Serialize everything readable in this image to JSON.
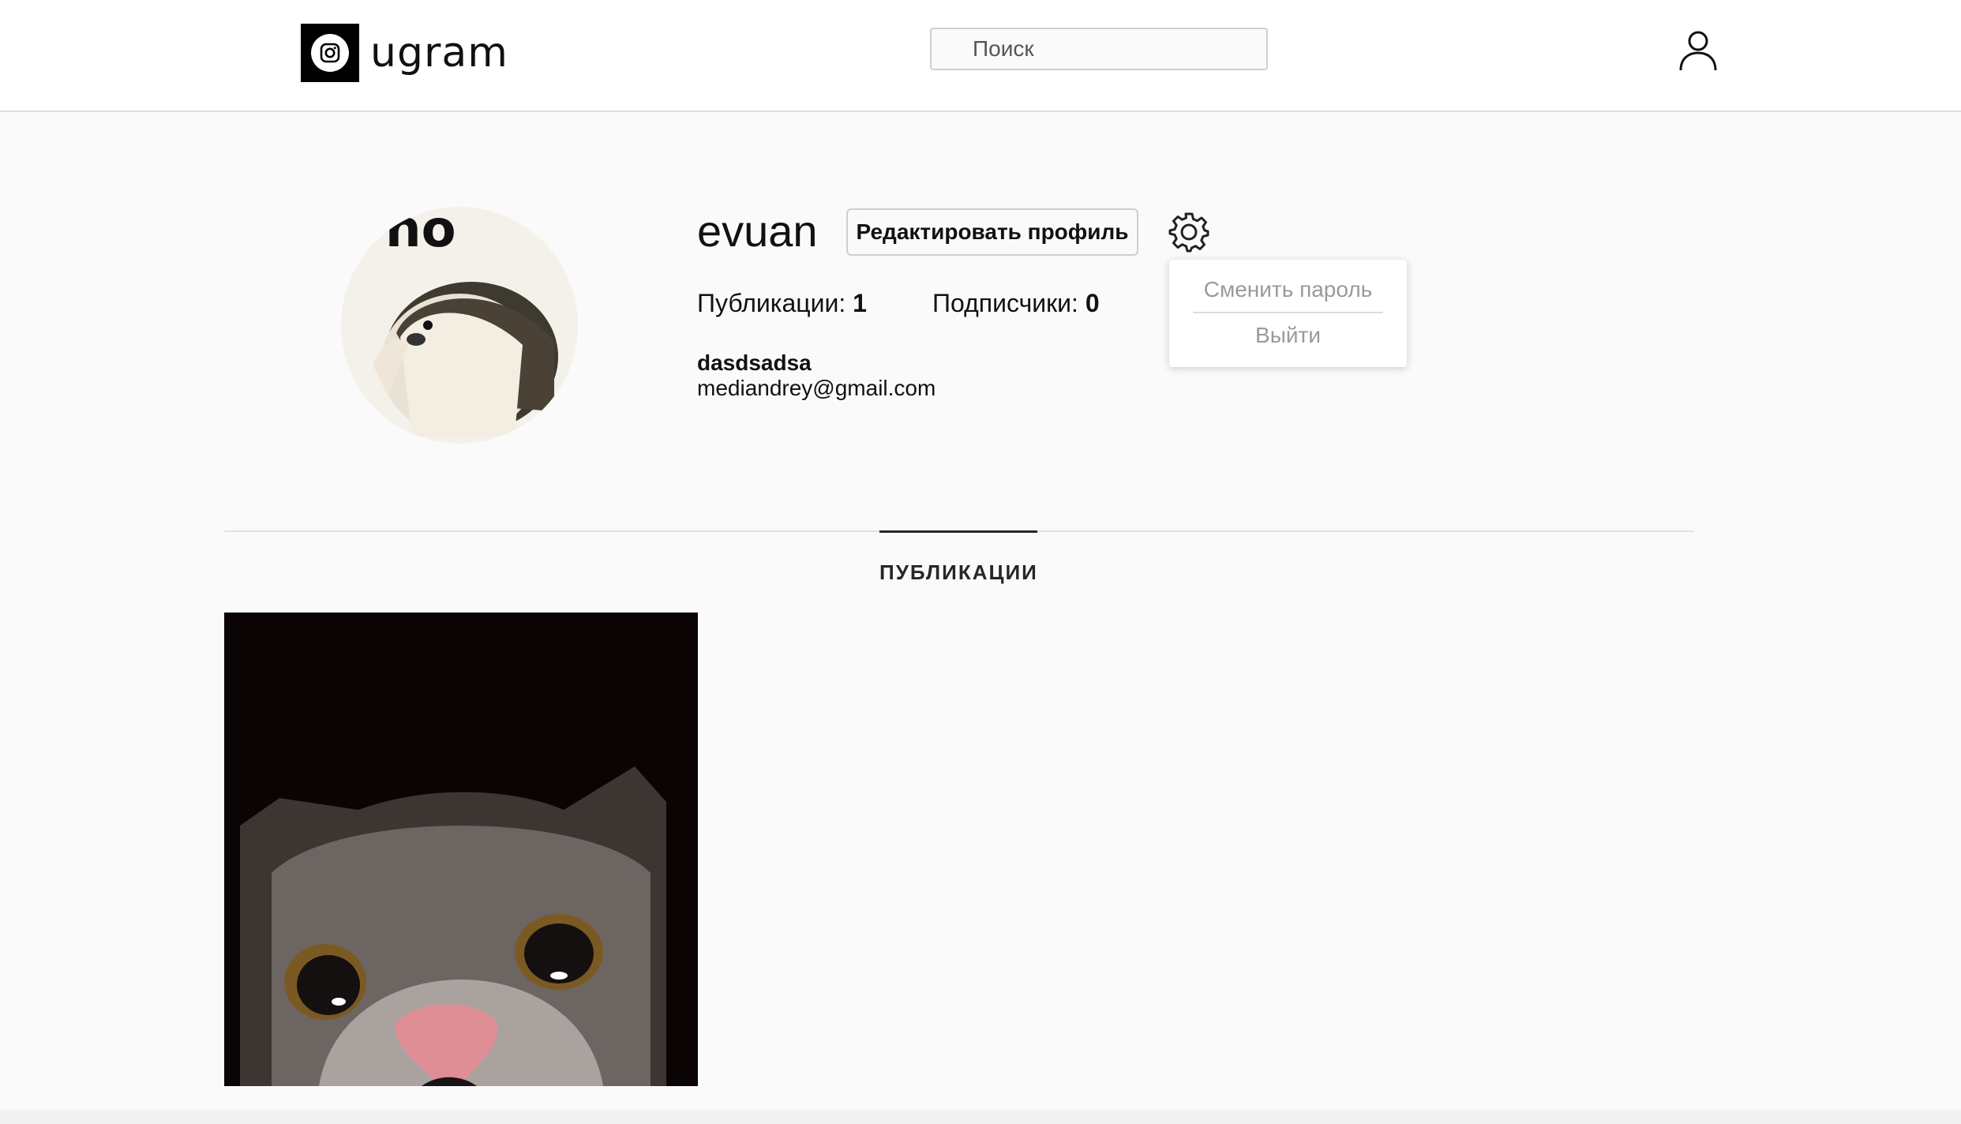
{
  "header": {
    "logo_text": "ugram",
    "search_placeholder": "Поиск"
  },
  "profile": {
    "username": "evuan",
    "edit_button": "Редактировать профиль",
    "stats": {
      "posts_label": "Публикации:",
      "posts_count": "1",
      "subscribers_label": "Подписчики:",
      "subscribers_count": "0"
    },
    "full_name": "dasdsadsa",
    "email": "mediandrey@gmail.com",
    "avatar_caption": "no"
  },
  "settings_menu": {
    "items": [
      "Сменить пароль",
      "Выйти"
    ]
  },
  "tabs": {
    "active": "ПУБЛИКАЦИИ"
  },
  "icons": [
    "instagram-logo-icon",
    "user-icon",
    "gear-icon"
  ]
}
